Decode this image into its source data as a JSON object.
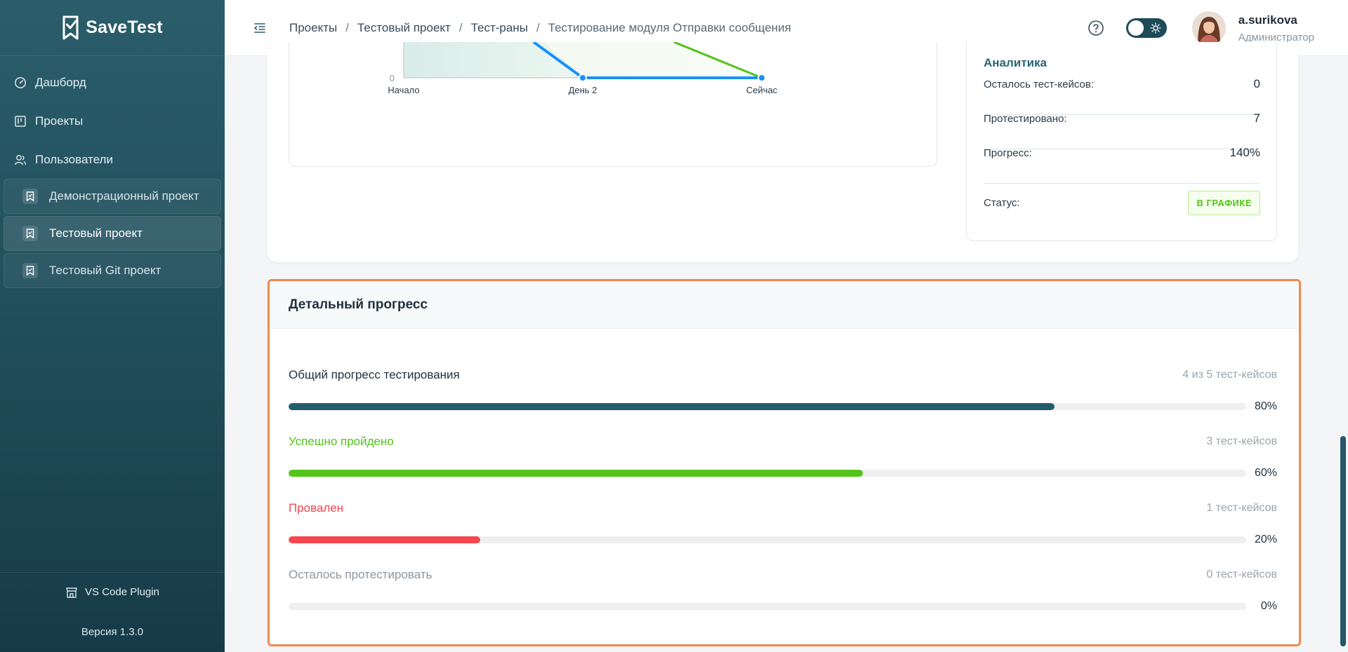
{
  "sidebar": {
    "brand": "SaveTest",
    "nav": [
      {
        "label": "Дашборд",
        "icon": "dashboard-icon"
      },
      {
        "label": "Проекты",
        "icon": "projects-icon"
      },
      {
        "label": "Пользователи",
        "icon": "users-icon"
      }
    ],
    "projects": [
      {
        "label": "Демонстрационный проект",
        "active": false
      },
      {
        "label": "Тестовый проект",
        "active": true
      },
      {
        "label": "Тестовый Git проект",
        "active": false
      }
    ],
    "plugin_label": "VS Code Plugin",
    "version": "Версия 1.3.0"
  },
  "header": {
    "breadcrumbs": [
      "Проекты",
      "Тестовый проект",
      "Тест-раны",
      "Тестирование модуля Отправки сообщения"
    ],
    "user_name": "a.surikova",
    "user_role": "Администратор"
  },
  "chart_data": {
    "type": "line",
    "categories": [
      "Начало",
      "День 2",
      "Сейчас"
    ],
    "y_tick_visible": "0",
    "series": [
      {
        "color": "#1890ff",
        "values_visible": [
          null,
          0,
          0
        ]
      },
      {
        "color": "#52c41a",
        "values_visible": [
          null,
          null,
          0
        ]
      }
    ],
    "grid": false
  },
  "analytics": {
    "title": "Аналитика",
    "rows": [
      {
        "label": "Осталось тест-кейсов:",
        "value": "0"
      },
      {
        "label": "Протестировано:",
        "value": "7"
      },
      {
        "label": "Прогресс:",
        "value": "140%"
      }
    ],
    "status_label": "Статус:",
    "status_badge": "В ГРАФИКЕ"
  },
  "detail": {
    "title": "Детальный прогресс",
    "rows": [
      {
        "label": "Общий прогресс тестирования",
        "count": "4 из 5 тест-кейсов",
        "percent": "80%",
        "value": 0.8,
        "color": "#245c6b",
        "label_color": "#22313d"
      },
      {
        "label": "Успешно пройдено",
        "count": "3 тест-кейсов",
        "percent": "60%",
        "value": 0.6,
        "color": "#52c41a",
        "label_color": "#52c41a"
      },
      {
        "label": "Провален",
        "count": "1 тест-кейсов",
        "percent": "20%",
        "value": 0.2,
        "color": "#f5474f",
        "label_color": "#f5474f"
      },
      {
        "label": "Осталось протестировать",
        "count": "0 тест-кейсов",
        "percent": "0%",
        "value": 0.0,
        "color": "#9aa4ac",
        "label_color": "#8c969e"
      }
    ]
  }
}
